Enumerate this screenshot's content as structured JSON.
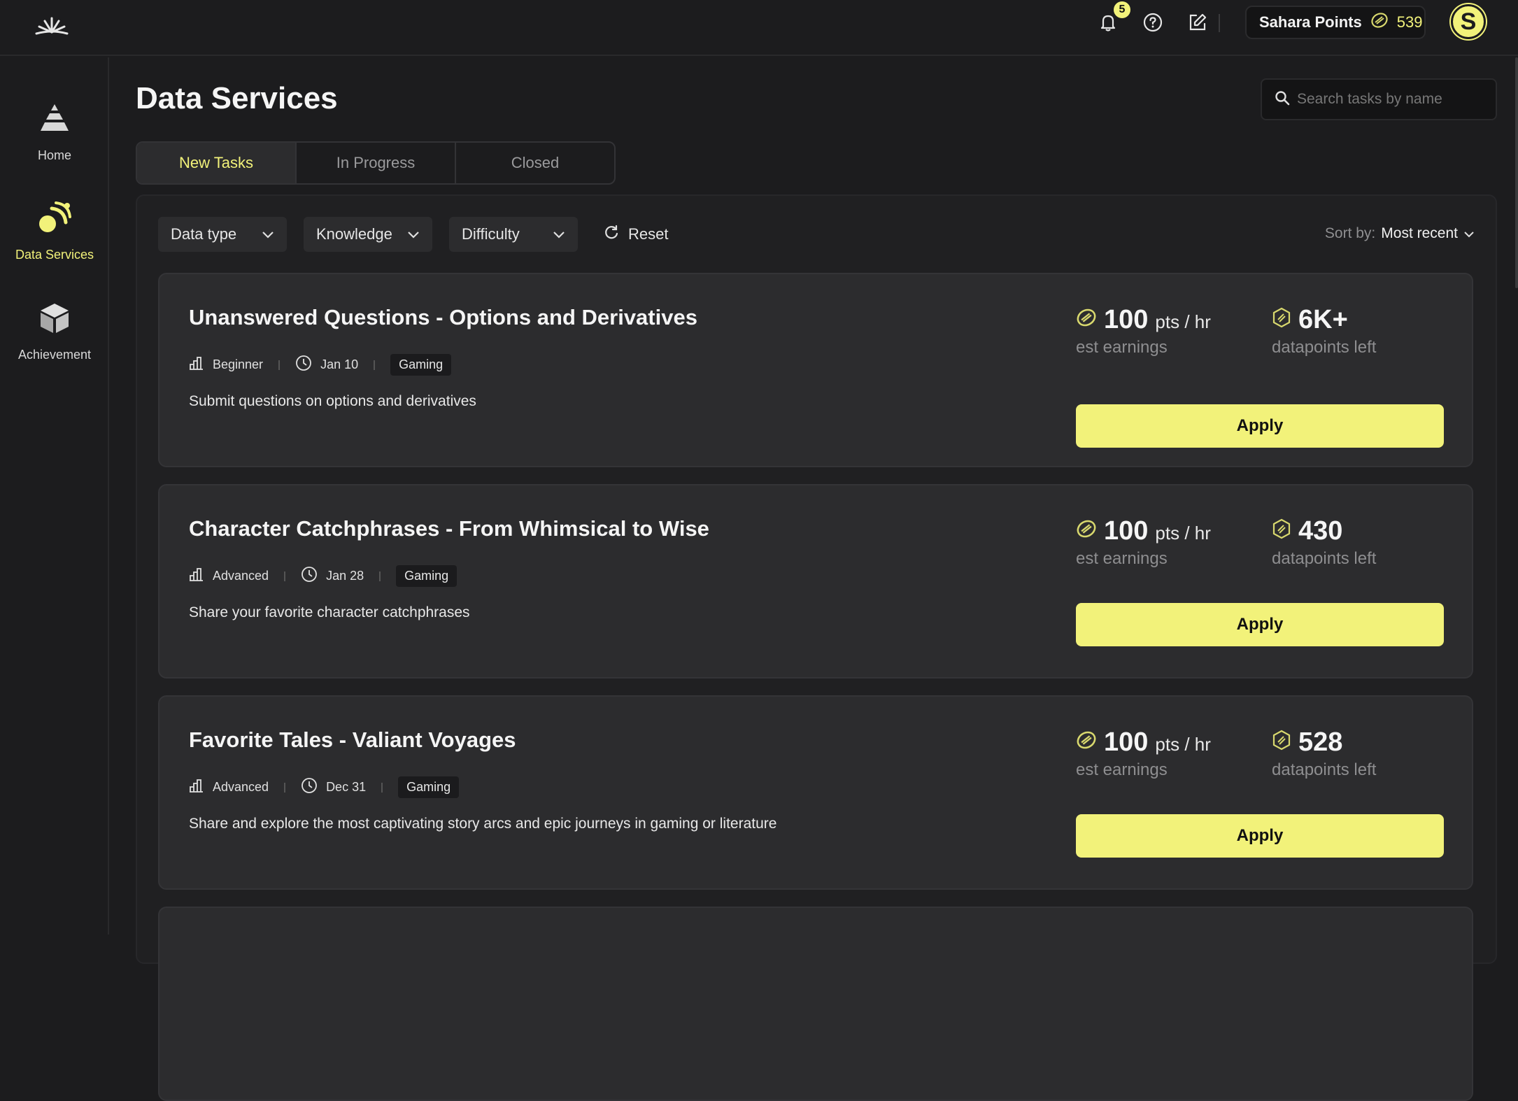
{
  "header": {
    "notifications_count": "5",
    "points_label": "Sahara Points",
    "points_value": "539",
    "avatar_letter": "S"
  },
  "sidebar": {
    "items": [
      {
        "label": "Home",
        "icon": "pyramid-icon"
      },
      {
        "label": "Data Services",
        "icon": "data-services-icon",
        "active": true
      },
      {
        "label": "Achievement",
        "icon": "cube-icon"
      }
    ]
  },
  "page": {
    "title": "Data Services",
    "search_placeholder": "Search tasks by name"
  },
  "tabs": [
    {
      "label": "New Tasks",
      "active": true
    },
    {
      "label": "In Progress"
    },
    {
      "label": "Closed"
    }
  ],
  "filters": {
    "data_type": "Data type",
    "knowledge": "Knowledge",
    "difficulty": "Difficulty",
    "reset": "Reset",
    "sort_label": "Sort by:",
    "sort_value": "Most recent"
  },
  "tasks": [
    {
      "title": "Unanswered Questions - Options and Derivatives",
      "level": "Beginner",
      "date": "Jan 10",
      "tag": "Gaming",
      "description": "Submit questions on options and derivatives",
      "earnings_value": "100",
      "earnings_unit": "pts / hr",
      "earnings_label": "est earnings",
      "datapoints_value": "6K+",
      "datapoints_label": "datapoints left",
      "apply_label": "Apply"
    },
    {
      "title": "Character Catchphrases - From Whimsical to Wise",
      "level": "Advanced",
      "date": "Jan 28",
      "tag": "Gaming",
      "description": "Share your favorite character catchphrases",
      "earnings_value": "100",
      "earnings_unit": "pts / hr",
      "earnings_label": "est earnings",
      "datapoints_value": "430",
      "datapoints_label": "datapoints left",
      "apply_label": "Apply"
    },
    {
      "title": "Favorite Tales - Valiant Voyages",
      "level": "Advanced",
      "date": "Dec 31",
      "tag": "Gaming",
      "description": "Share and explore the most captivating story arcs and epic journeys in gaming or literature",
      "earnings_value": "100",
      "earnings_unit": "pts / hr",
      "earnings_label": "est earnings",
      "datapoints_value": "528",
      "datapoints_label": "datapoints left",
      "apply_label": "Apply"
    }
  ],
  "colors": {
    "accent": "#f2f27a",
    "background": "#1c1c1e",
    "card": "#2c2c2e"
  }
}
